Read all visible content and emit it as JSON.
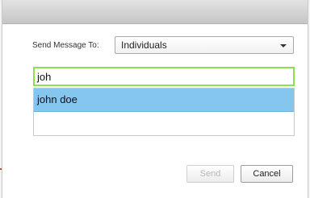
{
  "dialog": {
    "recipient_label": "Send Message To:",
    "recipient_select": {
      "value": "Individuals",
      "icon": "chevron-down-icon"
    },
    "search": {
      "value": "joh"
    },
    "suggestions": [
      {
        "label": "john doe"
      }
    ],
    "buttons": {
      "send_label": "Send",
      "cancel_label": "Cancel"
    }
  },
  "colors": {
    "search_focus_border": "#8be24a",
    "suggestion_highlight": "#85c6ef"
  }
}
